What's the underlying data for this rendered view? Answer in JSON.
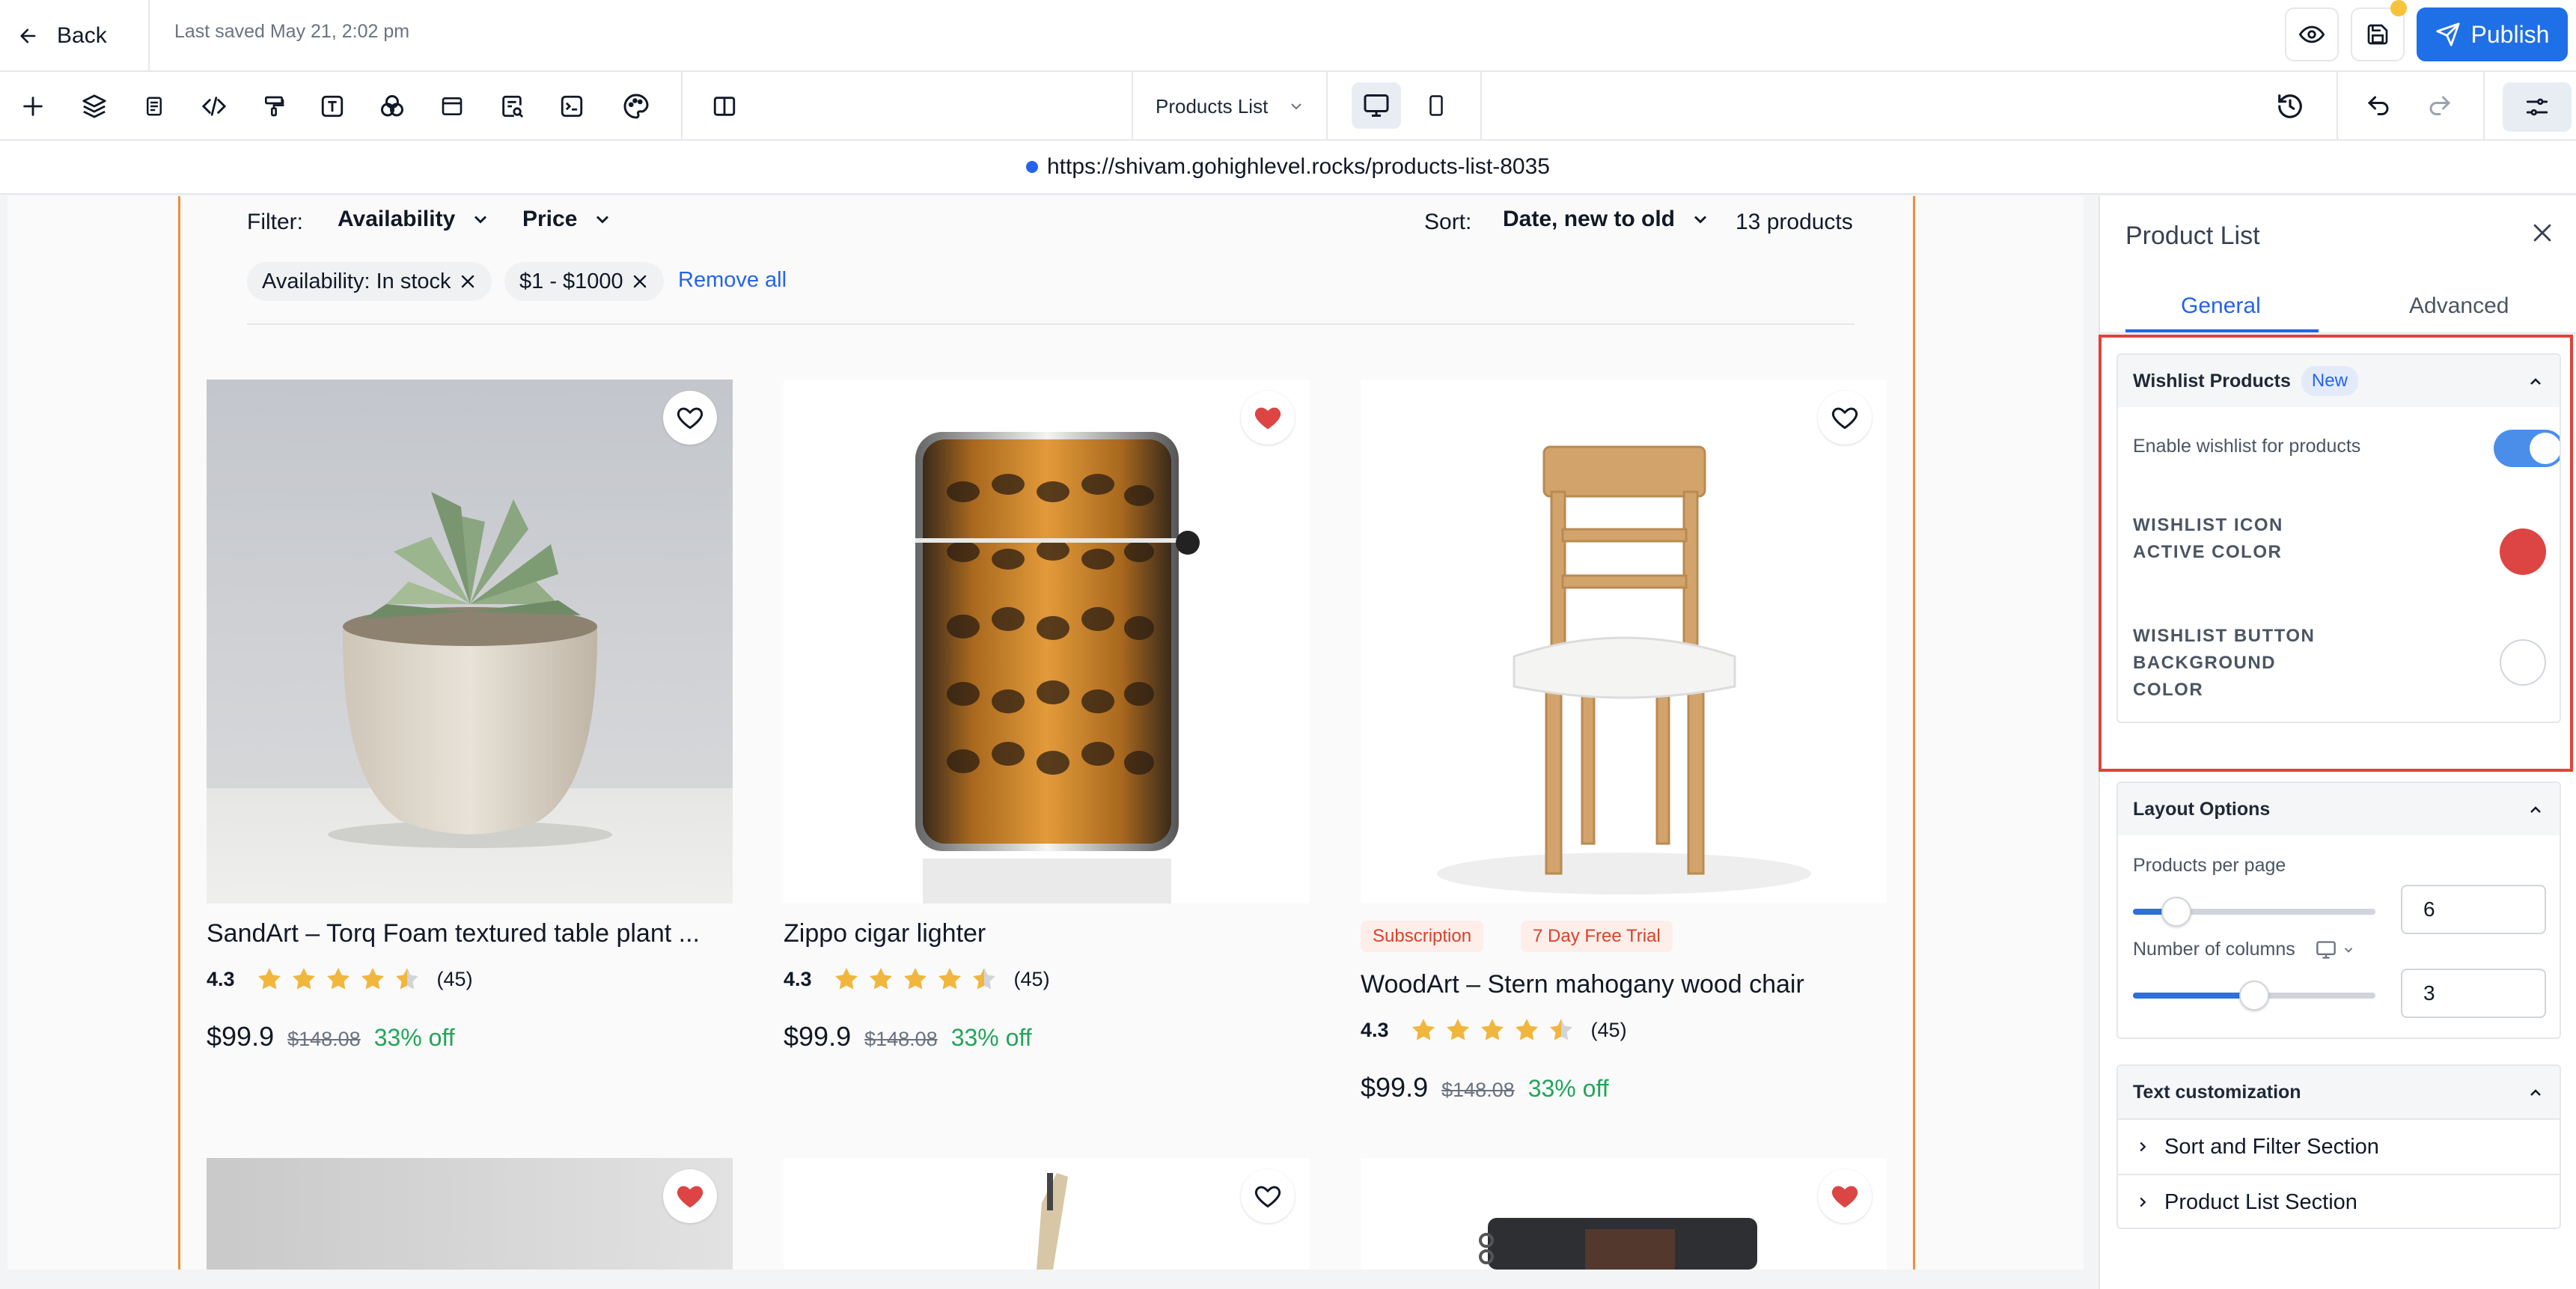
{
  "topbar": {
    "back_label": "Back",
    "last_saved": "Last saved May 21, 2:02 pm",
    "publish_label": "Publish"
  },
  "toolbar": {
    "page_selector": "Products List"
  },
  "url": "https://shivam.gohighlevel.rocks/products-list-8035",
  "filters": {
    "label": "Filter:",
    "availability": "Availability",
    "price": "Price",
    "sort_label": "Sort:",
    "sort_value": "Date, new to old",
    "count": "13 products",
    "chips": [
      "Availability: In stock",
      "$1 - $1000"
    ],
    "remove_all": "Remove all"
  },
  "products": [
    {
      "title": "SandArt – Torq Foam textured table plant ...",
      "rating": "4.3",
      "stars": 4.5,
      "reviews": "(45)",
      "price": "$99.9",
      "old_price": "$148.08",
      "discount": "33% off",
      "wishlisted": false,
      "tags": []
    },
    {
      "title": "Zippo cigar lighter",
      "rating": "4.3",
      "stars": 4.5,
      "reviews": "(45)",
      "price": "$99.9",
      "old_price": "$148.08",
      "discount": "33% off",
      "wishlisted": true,
      "tags": []
    },
    {
      "title": "WoodArt – Stern mahogany wood chair",
      "rating": "4.3",
      "stars": 4.5,
      "reviews": "(45)",
      "price": "$99.9",
      "old_price": "$148.08",
      "discount": "33% off",
      "wishlisted": false,
      "tags": [
        "Subscription",
        "7 Day Free Trial"
      ]
    }
  ],
  "second_row_wishlisted": [
    true,
    false,
    true
  ],
  "panel": {
    "title": "Product List",
    "tabs": [
      "General",
      "Advanced"
    ],
    "active_tab": "General",
    "wishlist": {
      "header": "Wishlist Products",
      "badge": "New",
      "enable_label": "Enable wishlist for products",
      "enabled": true,
      "icon_color_label_1": "WISHLIST ICON",
      "icon_color_label_2": "ACTIVE COLOR",
      "icon_active_color": "#dc4543",
      "bg_color_label_1": "WISHLIST BUTTON",
      "bg_color_label_2": "BACKGROUND",
      "bg_color_label_3": "COLOR",
      "bg_color": "#ffffff"
    },
    "layout": {
      "header": "Layout Options",
      "products_per_page_label": "Products per page",
      "products_per_page": "6",
      "columns_label": "Number of columns",
      "columns": "3"
    },
    "text": {
      "header": "Text customization",
      "items": [
        "Sort and Filter Section",
        "Product List Section"
      ]
    }
  },
  "colors": {
    "accent": "#1f6fe6",
    "guide": "#ef8e3e",
    "heart_active": "#dc4543",
    "discount": "#22a55a",
    "star": "#f0b63d"
  }
}
